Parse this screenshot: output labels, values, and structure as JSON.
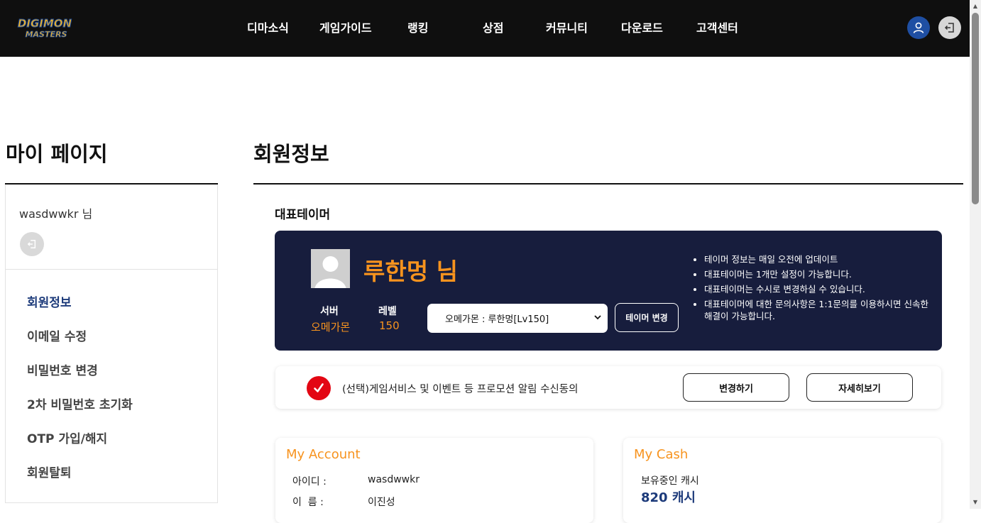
{
  "header": {
    "logo_line1": "DIGIMON",
    "logo_line2": "MASTERS",
    "nav": [
      "디마소식",
      "게임가이드",
      "랭킹",
      "상점",
      "커뮤니티",
      "다운로드",
      "고객센터"
    ],
    "user_icon": "user-icon",
    "logout_icon": "logout-icon"
  },
  "sidebar": {
    "title": "마이 페이지",
    "username": "wasdwwkr 님",
    "items": [
      {
        "label": "회원정보",
        "active": true
      },
      {
        "label": "이메일 수정",
        "active": false
      },
      {
        "label": "비밀번호 변경",
        "active": false
      },
      {
        "label": "2차 비밀번호 초기화",
        "active": false
      },
      {
        "label": "OTP 가입/해지",
        "active": false
      },
      {
        "label": "회원탈퇴",
        "active": false
      }
    ]
  },
  "main": {
    "title": "회원정보",
    "rep_tamer": {
      "section_title": "대표테이머",
      "name": "루한멍 님",
      "server_label": "서버",
      "server_value": "오메가몬",
      "level_label": "레벨",
      "level_value": "150",
      "select_value": "오메가몬 : 루한멍[Lv150]",
      "change_button": "테이머 변경",
      "notes": [
        "테이머 정보는 매일 오전에 업데이트",
        "대표테이머는 1개만 설정이 가능합니다.",
        "대표테이머는 수시로 변경하실 수 있습니다.",
        "대표테이머에 대한 문의사항은 1:1문의를 이용하시면 신속한 해결이 가능합니다."
      ]
    },
    "consent": {
      "text": "(선택)게임서비스 및 이벤트 등 프로모션 알림 수신동의",
      "change_button": "변경하기",
      "detail_button": "자세히보기"
    },
    "account": {
      "title": "My Account",
      "id_label": "아이디 :",
      "id_value": "wasdwwkr",
      "name_label": "이  름 :",
      "name_value": "이진성"
    },
    "cash": {
      "title": "My Cash",
      "label": "보유중인 캐시",
      "value": "820 캐시"
    }
  },
  "colors": {
    "header_bg": "#0f0f0f",
    "accent_orange": "#f7931e",
    "navy_card": "#171d3d",
    "active_blue": "#1c3a7a",
    "check_red": "#e30613"
  }
}
